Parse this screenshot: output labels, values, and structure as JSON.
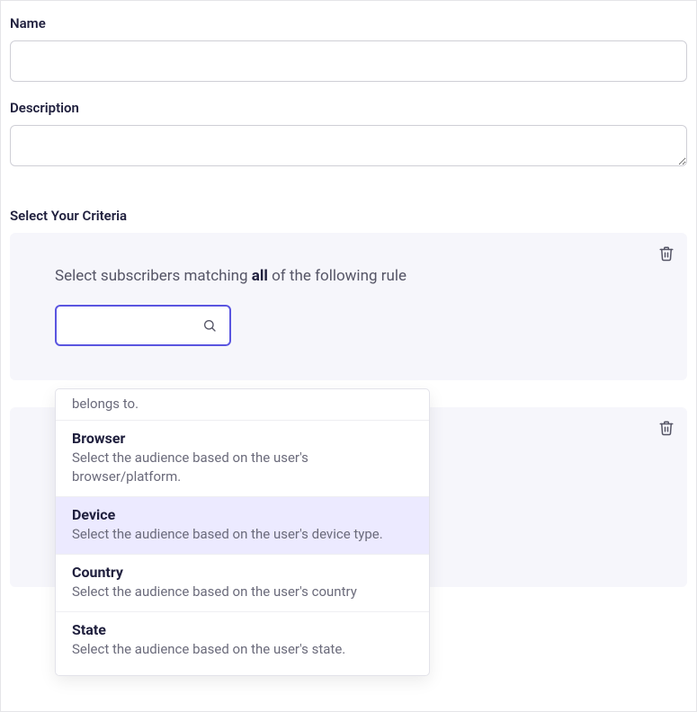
{
  "name_field": {
    "label": "Name",
    "value": ""
  },
  "description_field": {
    "label": "Description",
    "value": ""
  },
  "criteria": {
    "heading": "Select Your Criteria",
    "rule_text_prefix": "Select subscribers matching ",
    "rule_text_bold": "all",
    "rule_text_suffix": " of the following rule",
    "search_value": ""
  },
  "dropdown": {
    "partial_text": "belongs to.",
    "items": [
      {
        "title": "Browser",
        "desc": "Select the audience based on the user's browser/platform.",
        "highlighted": false
      },
      {
        "title": "Device",
        "desc": "Select the audience based on the user's device type.",
        "highlighted": true
      },
      {
        "title": "Country",
        "desc": "Select the audience based on the user's country",
        "highlighted": false
      },
      {
        "title": "State",
        "desc": "Select the audience based on the user's state.",
        "highlighted": false
      }
    ]
  }
}
